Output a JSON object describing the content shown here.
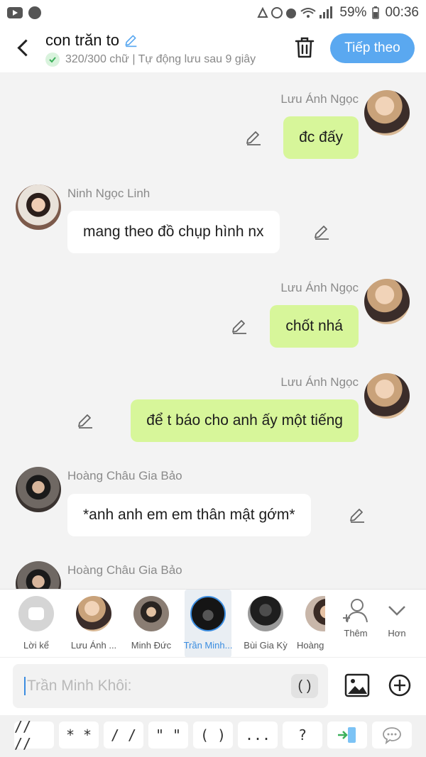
{
  "status_bar": {
    "battery": "59%",
    "time": "00:36"
  },
  "header": {
    "title": "con trăn to",
    "subtitle": "320/300 chữ | Tự động lưu sau 9 giây",
    "next_label": "Tiếp theo"
  },
  "messages": [
    {
      "sender": "Lưu Ánh Ngọc",
      "text": "đc đấy",
      "side": "right"
    },
    {
      "sender": "Ninh Ngọc Linh",
      "text": "mang theo đồ chụp hình nx",
      "side": "left"
    },
    {
      "sender": "Lưu Ánh Ngọc",
      "text": "chốt nhá",
      "side": "right"
    },
    {
      "sender": "Lưu Ánh Ngọc",
      "text": "để t báo cho anh ấy một tiếng",
      "side": "right"
    },
    {
      "sender": "Hoàng Châu Gia Bảo",
      "text": "*anh anh em em thân mật gớm*",
      "side": "left"
    },
    {
      "sender": "Hoàng Châu Gia Bảo",
      "text": "",
      "side": "left"
    }
  ],
  "characters": [
    {
      "label": "Lời kể",
      "selected": false
    },
    {
      "label": "Lưu Ánh ...",
      "selected": false
    },
    {
      "label": "Minh Đức",
      "selected": false
    },
    {
      "label": "Trần Minh...",
      "selected": true
    },
    {
      "label": "Bùi Gia Kỳ",
      "selected": false
    },
    {
      "label": "Hoàng",
      "selected": false
    }
  ],
  "char_actions": {
    "add_label": "Thêm",
    "more_label": "Hơn"
  },
  "input": {
    "placeholder": "Trần Minh Khôi:",
    "paren_label": "( )"
  },
  "quick_symbols": [
    "// //",
    "* *",
    "/ /",
    "\" \"",
    "( )",
    "...",
    "?"
  ],
  "colors": {
    "accent": "#5aa8f0",
    "bubble_green": "#d7f69a",
    "selected_blue": "#3b8de0"
  }
}
